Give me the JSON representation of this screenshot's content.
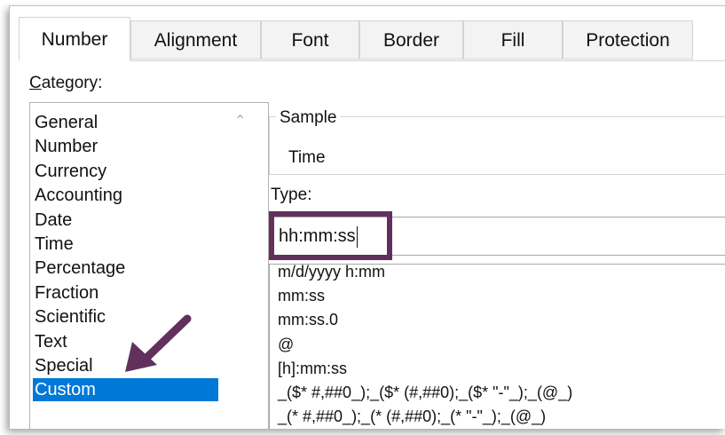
{
  "tabs": [
    {
      "label": "Number",
      "active": true
    },
    {
      "label": "Alignment",
      "active": false
    },
    {
      "label": "Font",
      "active": false
    },
    {
      "label": "Border",
      "active": false
    },
    {
      "label": "Fill",
      "active": false
    },
    {
      "label": "Protection",
      "active": false
    }
  ],
  "category": {
    "label_mnemonic": "C",
    "label_rest": "ategory:",
    "items": [
      "General",
      "Number",
      "Currency",
      "Accounting",
      "Date",
      "Time",
      "Percentage",
      "Fraction",
      "Scientific",
      "Text",
      "Special",
      "Custom"
    ],
    "selected": "Custom"
  },
  "sample": {
    "legend": "Sample",
    "value": "Time"
  },
  "type": {
    "label": "Type:",
    "value": "hh:mm:ss",
    "formats": [
      "m/d/yyyy h:mm",
      "mm:ss",
      "mm:ss.0",
      "@",
      "[h]:mm:ss",
      "_($* #,##0_);_($* (#,##0);_($* \"-\"_);_(@_)",
      "_(* #,##0_);_(* (#,##0);_(* \"-\"_);_(@_)"
    ]
  },
  "colors": {
    "selection": "#0078d7",
    "highlight": "#62305c"
  }
}
